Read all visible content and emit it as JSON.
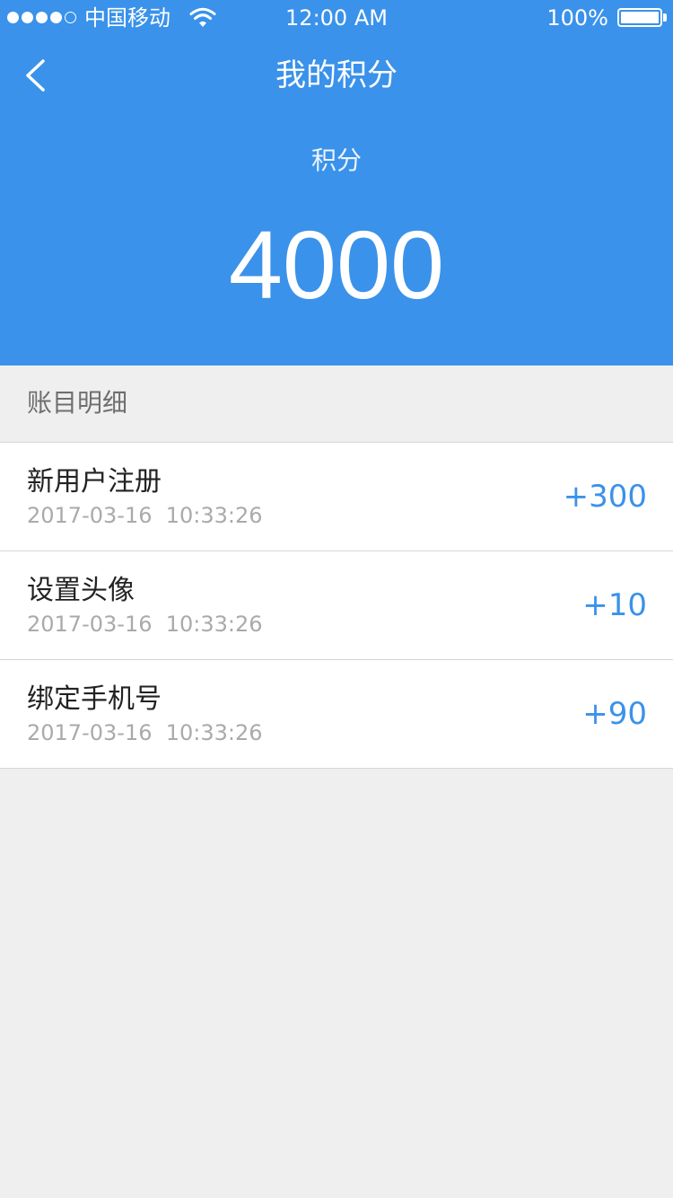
{
  "status_bar": {
    "carrier": "中国移动",
    "time": "12:00 AM",
    "battery": "100%",
    "signal_bars_filled": 4,
    "signal_bars_total": 5
  },
  "nav": {
    "title": "我的积分",
    "back_icon": "chevron-left-icon"
  },
  "points": {
    "label": "积分",
    "value": "4000"
  },
  "section": {
    "title": "账目明细"
  },
  "records": [
    {
      "title": "新用户注册",
      "time": "2017-03-16  10:33:26",
      "amount": "+300"
    },
    {
      "title": "设置头像",
      "time": "2017-03-16  10:33:26",
      "amount": "+10"
    },
    {
      "title": "绑定手机号",
      "time": "2017-03-16  10:33:26",
      "amount": "+90"
    }
  ],
  "colors": {
    "brand_blue": "#3a92ea",
    "background": "#efefef",
    "amount": "#3a92ea"
  }
}
